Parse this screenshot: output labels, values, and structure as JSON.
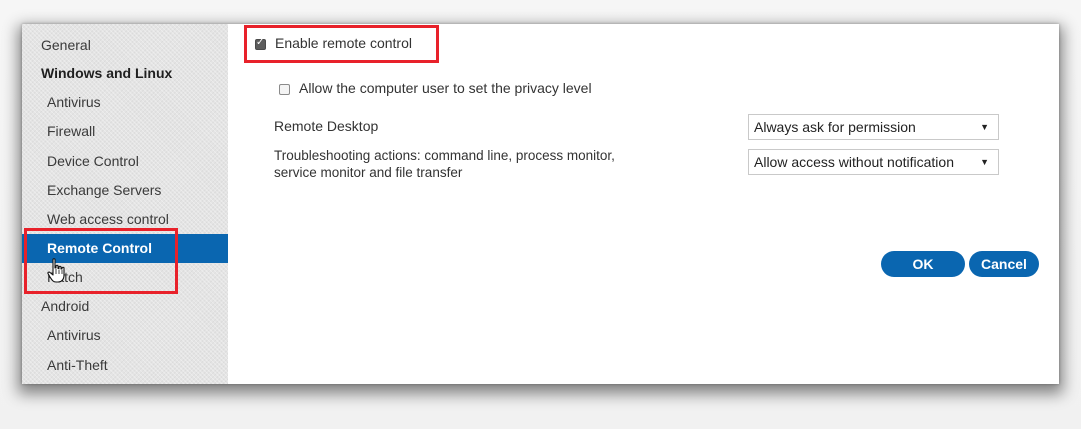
{
  "sidebar": {
    "items": [
      {
        "label": "General"
      },
      {
        "label": "Windows and Linux"
      },
      {
        "label": "Antivirus"
      },
      {
        "label": "Firewall"
      },
      {
        "label": "Device Control"
      },
      {
        "label": "Exchange Servers"
      },
      {
        "label": "Web access control"
      },
      {
        "label": "Remote Control"
      },
      {
        "label": "Patch"
      },
      {
        "label": "Android"
      },
      {
        "label": "Antivirus"
      },
      {
        "label": "Anti-Theft"
      }
    ],
    "active_item": "Remote Control",
    "active_color": "#0a66b0"
  },
  "main": {
    "enable_remote_control": {
      "label": "Enable remote control",
      "checked": true
    },
    "allow_privacy_level": {
      "label": "Allow the computer user to set the privacy level",
      "checked": false
    },
    "remote_desktop": {
      "label": "Remote Desktop",
      "selected": "Always ask for permission"
    },
    "troubleshooting": {
      "label_line1": "Troubleshooting actions: command line, process monitor,",
      "label_line2": "service monitor and file transfer",
      "selected": "Allow access without notification"
    }
  },
  "buttons": {
    "ok_label": "OK",
    "cancel_label": "Cancel"
  },
  "icons": {
    "dropdown_arrow": "▼",
    "cursor": "hand-pointer-icon"
  },
  "highlight_color": "#e8212a"
}
